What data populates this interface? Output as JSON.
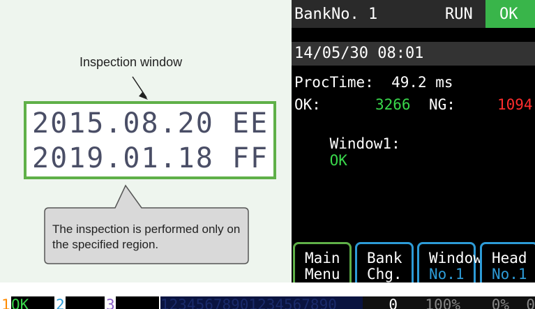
{
  "illustration": {
    "inspection_label": "Inspection window",
    "code_lines": [
      "2015.08.20 EE",
      "2019.01.18 FF"
    ],
    "callout": "The inspection is performed only on the specified region."
  },
  "screen": {
    "bank": "BankNo. 1",
    "run_status": "RUN",
    "result": "OK",
    "datetime": "14/05/30 08:01",
    "proc_time": "ProcTime:  49.2 ms",
    "ok_label": "OK:",
    "ok_count": "3266",
    "ng_label": "NG:",
    "ng_count": "1094",
    "window_label": "Window1:",
    "window_result": "OK",
    "softkeys": [
      {
        "line1": "Main",
        "line2": "Menu"
      },
      {
        "line1": "Bank",
        "line2": "Chg."
      },
      {
        "line1": "Window",
        "line2": "No.1"
      },
      {
        "line1": "Head",
        "line2": "No.1"
      }
    ],
    "colors": {
      "ok": "#39b54a",
      "ng": "#ff2d2d",
      "key_border": "#2d9bd7",
      "key_first_border": "#5fb048"
    }
  },
  "statusbar": {
    "slot1_num": "1",
    "slot1_status": "OK",
    "slot2_num": "2",
    "slot3_num": "3",
    "sequence": "12345678901234567890",
    "value_a": "0",
    "value_b": "100%",
    "value_c": "0%",
    "value_d": "0"
  }
}
